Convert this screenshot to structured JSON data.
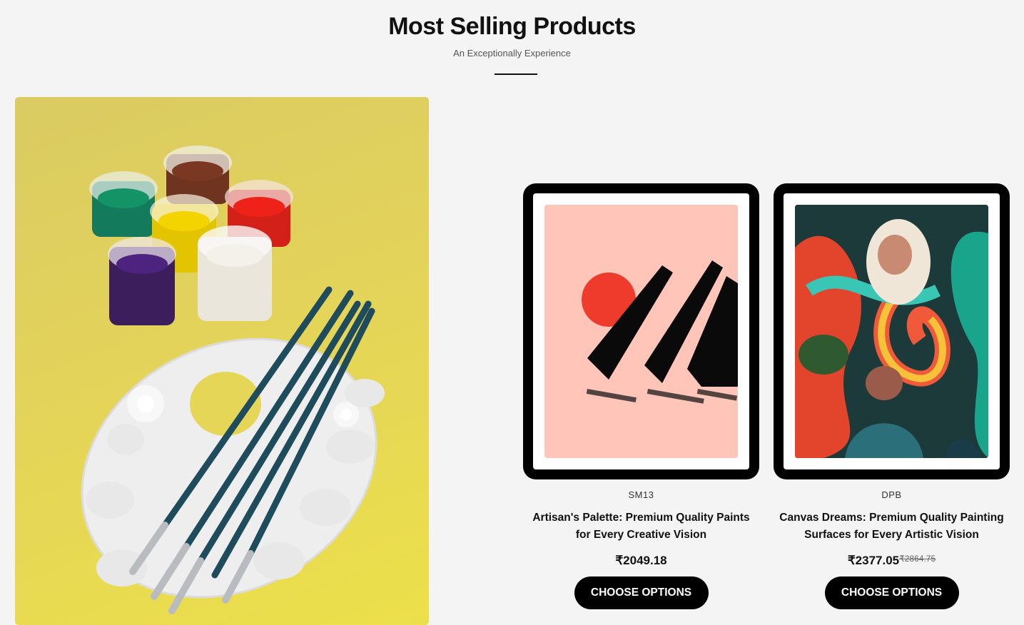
{
  "section": {
    "title": "Most Selling Products",
    "subtitle": "An Exceptionally Experience"
  },
  "hero": {
    "image": "paint-pots-palette-brushes",
    "background": "#e3d35a"
  },
  "products": [
    {
      "sku": "SM13",
      "name": "Artisan's Palette: Premium Quality Paints for Every Creative Vision",
      "price": "₹2049.18",
      "old_price": "",
      "button": "CHOOSE OPTIONS",
      "art": "red-sun-black-dominoes",
      "art_bg": "#fec5b8"
    },
    {
      "sku": "DPB",
      "name": "Canvas Dreams: Premium Quality Painting Surfaces for Every Artistic Vision",
      "price": "₹2377.05",
      "old_price": "₹2864.75",
      "button": "CHOOSE OPTIONS",
      "art": "psychedelic-rainbow-figures",
      "art_bg": "#1b2a3a"
    }
  ]
}
